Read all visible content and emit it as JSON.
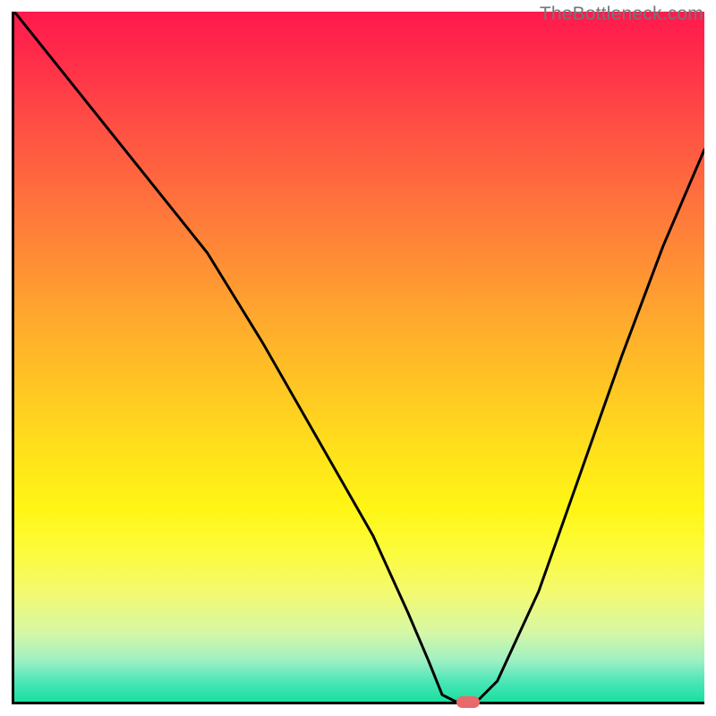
{
  "watermark": "TheBottleneck.com",
  "chart_data": {
    "type": "line",
    "title": "",
    "xlabel": "",
    "ylabel": "",
    "xlim": [
      0,
      100
    ],
    "ylim": [
      0,
      100
    ],
    "grid": false,
    "legend": false,
    "background": {
      "type": "vertical-gradient",
      "stops": [
        {
          "pos": 0,
          "color": "#ff1a4d"
        },
        {
          "pos": 50,
          "color": "#ffc823"
        },
        {
          "pos": 80,
          "color": "#fcfb3a"
        },
        {
          "pos": 100,
          "color": "#1adf9f"
        }
      ]
    },
    "series": [
      {
        "name": "bottleneck-curve",
        "color": "#000000",
        "x": [
          0,
          8,
          16,
          24,
          28,
          36,
          44,
          52,
          57,
          60,
          62,
          64,
          67,
          70,
          76,
          82,
          88,
          94,
          100
        ],
        "values": [
          100,
          90,
          80,
          70,
          65,
          52,
          38,
          24,
          13,
          6,
          1,
          0,
          0,
          3,
          16,
          33,
          50,
          66,
          80
        ]
      }
    ],
    "marker": {
      "name": "optimal-point",
      "x": 65.5,
      "y": 0,
      "color": "#e86a6a",
      "shape": "pill"
    }
  }
}
